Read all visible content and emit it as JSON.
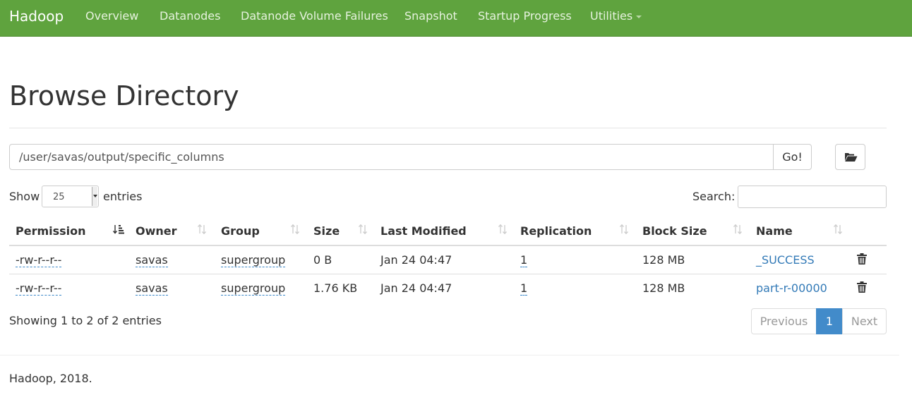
{
  "navbar": {
    "brand": "Hadoop",
    "items": [
      {
        "label": "Overview"
      },
      {
        "label": "Datanodes"
      },
      {
        "label": "Datanode Volume Failures"
      },
      {
        "label": "Snapshot"
      },
      {
        "label": "Startup Progress"
      },
      {
        "label": "Utilities"
      }
    ],
    "accent_color": "#5fa33e"
  },
  "page": {
    "title": "Browse Directory"
  },
  "path_bar": {
    "value": "/user/savas/output/specific_columns",
    "go_label": "Go!",
    "folder_icon": "folder-open-icon"
  },
  "table_controls": {
    "show_label": "Show",
    "entries_value": "25",
    "entries_label": "entries",
    "search_label": "Search:",
    "search_value": ""
  },
  "table": {
    "columns": [
      {
        "label": "Permission",
        "sort": "sorted-ascending"
      },
      {
        "label": "Owner",
        "sort": "sortable"
      },
      {
        "label": "Group",
        "sort": "sortable"
      },
      {
        "label": "Size",
        "sort": "sortable"
      },
      {
        "label": "Last Modified",
        "sort": "sortable"
      },
      {
        "label": "Replication",
        "sort": "sortable"
      },
      {
        "label": "Block Size",
        "sort": "sortable"
      },
      {
        "label": "Name",
        "sort": "sortable"
      }
    ],
    "rows": [
      {
        "permission": "-rw-r--r--",
        "owner": "savas",
        "group": "supergroup",
        "size": "0 B",
        "last_modified": "Jan 24 04:47",
        "replication": "1",
        "block_size": "128 MB",
        "name": "_SUCCESS"
      },
      {
        "permission": "-rw-r--r--",
        "owner": "savas",
        "group": "supergroup",
        "size": "1.76 KB",
        "last_modified": "Jan 24 04:47",
        "replication": "1",
        "block_size": "128 MB",
        "name": "part-r-00000"
      }
    ]
  },
  "pagination": {
    "info": "Showing 1 to 2 of 2 entries",
    "previous": "Previous",
    "current_page": "1",
    "next": "Next"
  },
  "footer": {
    "text": "Hadoop, 2018."
  }
}
